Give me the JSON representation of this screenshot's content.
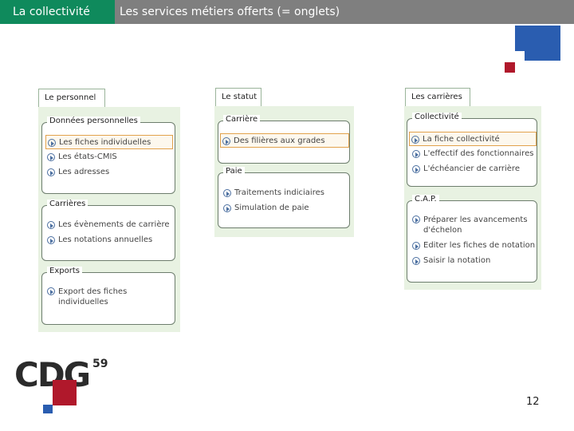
{
  "header": {
    "section": "La collectivité",
    "title": "Les services métiers offerts (= onglets)"
  },
  "colors": {
    "header_bg": "#7f7f7f",
    "tab_accent": "#0f8a5c",
    "brand_red": "#b0182b",
    "brand_blue": "#2a5db0",
    "panel_bg": "#e8f2e2",
    "selection": "#e2a24c"
  },
  "panels": [
    {
      "tab": "Le personnel",
      "groups": [
        {
          "title": "Données personnelles",
          "items": [
            "Les fiches individuelles",
            "Les états-CMIS",
            "Les adresses"
          ]
        },
        {
          "title": "Carrières",
          "items": [
            "Les évènements de carrière",
            "Les notations annuelles"
          ]
        },
        {
          "title": "Exports",
          "items": [
            "Export des fiches individuelles"
          ]
        }
      ]
    },
    {
      "tab": "Le statut",
      "groups": [
        {
          "title": "Carrière",
          "items": [
            "Des filières aux grades"
          ]
        },
        {
          "title": "Paie",
          "items": [
            "Traitements indiciaires",
            "Simulation de paie"
          ]
        }
      ]
    },
    {
      "tab": "Les carrières",
      "groups": [
        {
          "title": "Collectivité",
          "items": [
            "La fiche collectivité",
            "L'effectif des fonctionnaires",
            "L'échéancier de carrière"
          ]
        },
        {
          "title": "C.A.P.",
          "items": [
            "Préparer les avancements d'échelon",
            "Editer les fiches de notation",
            "Saisir la notation"
          ]
        }
      ]
    }
  ],
  "logo": {
    "text": "CDG",
    "superscript": "59"
  },
  "page_number": "12"
}
